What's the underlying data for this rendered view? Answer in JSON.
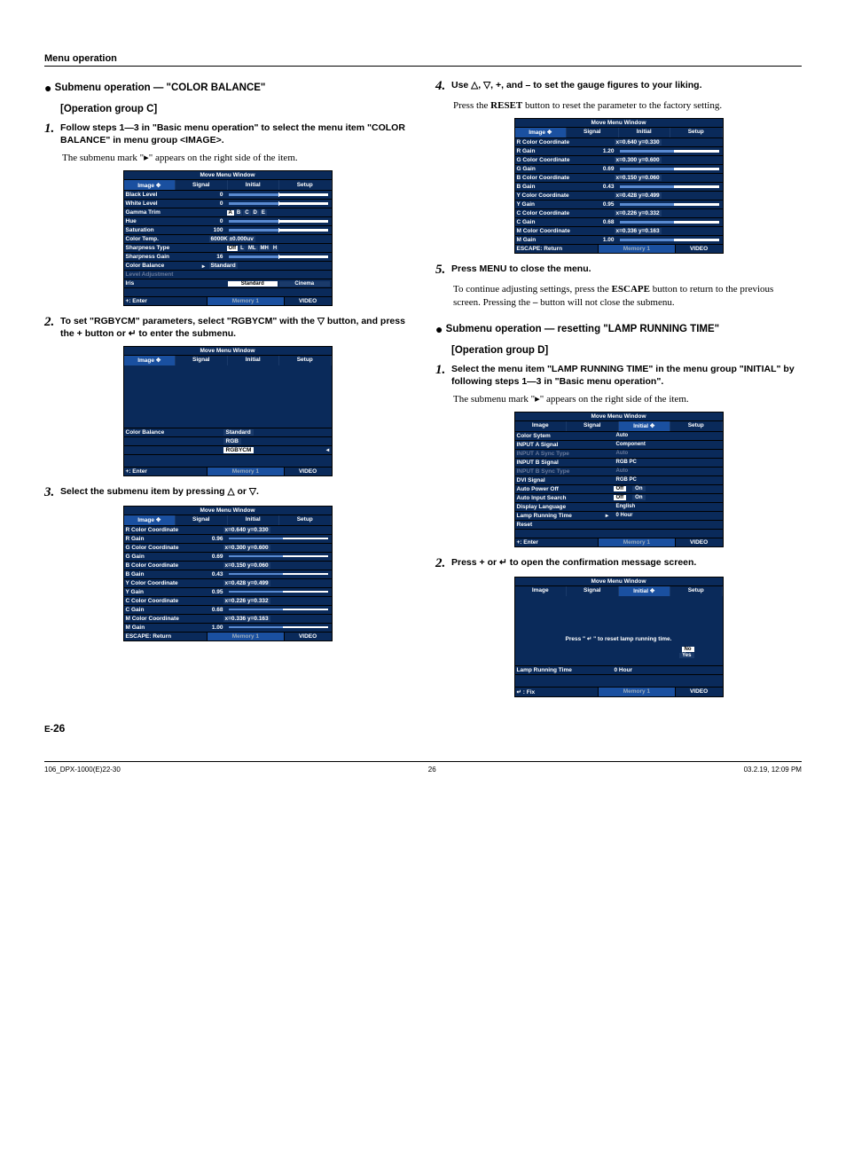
{
  "header": "Menu operation",
  "page_number_prefix": "E-",
  "page_number": "26",
  "footer": {
    "left": "106_DPX-1000(E)22-30",
    "center": "26",
    "right": "03.2.19, 12:09 PM"
  },
  "osd_common": {
    "title": "Move Menu Window",
    "tabs": [
      "Image",
      "Signal",
      "Initial",
      "Setup"
    ],
    "foot_enter": "+: Enter",
    "foot_escape": "ESCAPE: Return",
    "foot_fix": "↵ : Fix",
    "memory": "Memory 1",
    "video": "VIDEO"
  },
  "left": {
    "submenu_title": "Submenu operation — \"COLOR BALANCE\"",
    "opgroup": "[Operation group C]",
    "step1": "Follow steps 1—3 in \"Basic menu operation\" to select the menu item \"COLOR BALANCE\" in menu group <IMAGE>.",
    "step1_body_a": "The submenu mark \"",
    "step1_body_b": "\" appears on the right side of the item.",
    "osd1_rows": [
      {
        "label": "Black Level",
        "val": "0",
        "type": "gauge",
        "fill": 50
      },
      {
        "label": "White Level",
        "val": "0",
        "type": "gauge",
        "fill": 50
      },
      {
        "label": "Gamma Trim",
        "val": "",
        "type": "segs",
        "segs": [
          "A",
          "B",
          "C",
          "D",
          "E"
        ]
      },
      {
        "label": "Hue",
        "val": "0",
        "type": "gauge",
        "fill": 50
      },
      {
        "label": "Saturation",
        "val": "100",
        "type": "gauge",
        "fill": 50
      },
      {
        "label": "Color Temp.",
        "val": "",
        "type": "text",
        "text": "6000K  ±0.000uv"
      },
      {
        "label": "Sharpness Type",
        "val": "",
        "type": "segs",
        "segs": [
          "Off",
          "L",
          "ML",
          "MH",
          "H"
        ]
      },
      {
        "label": "Sharpness Gain",
        "val": "16",
        "type": "gauge",
        "fill": 50
      },
      {
        "label": "Color Balance",
        "val": "",
        "type": "text",
        "text": "Standard",
        "mark": "▸"
      },
      {
        "label": "Level Adjustment",
        "val": "",
        "type": "blank",
        "dim": true
      },
      {
        "label": "Iris",
        "val": "",
        "type": "opts",
        "opts": [
          "Standard",
          "Cinema"
        ]
      },
      {
        "label": "",
        "val": "",
        "type": "blank"
      }
    ],
    "step2": "To set \"RGBYCM\" parameters, select \"RGBYCM\" with the ▽ button, and press the + button or ↵ to enter the submenu.",
    "osd2_rows": [
      {
        "label": "Color Balance",
        "type": "text",
        "text": "Standard"
      },
      {
        "label": "",
        "type": "text",
        "text": "RGB"
      },
      {
        "label": "",
        "type": "text",
        "text": "RGBYCM",
        "mark": "◂"
      }
    ],
    "step3": "Select the submenu item by pressing △ or ▽.",
    "coord_rows": [
      {
        "label": "R Color Coordinate",
        "text": "x=0.640  y=0.330"
      },
      {
        "label": "R Gain",
        "val": "0.96"
      },
      {
        "label": "G Color Coordinate",
        "text": "x=0.300  y=0.600"
      },
      {
        "label": "G Gain",
        "val": "0.69"
      },
      {
        "label": "B Color Coordinate",
        "text": "x=0.150  y=0.060"
      },
      {
        "label": "B Gain",
        "val": "0.43"
      },
      {
        "label": "Y Color Coordinate",
        "text": "x=0.428  y=0.499"
      },
      {
        "label": "Y Gain",
        "val": "0.95"
      },
      {
        "label": "C Color Coordinate",
        "text": "x=0.226  y=0.332"
      },
      {
        "label": "C Gain",
        "val": "0.68"
      },
      {
        "label": "M Color Coordinate",
        "text": "x=0.336  y=0.163"
      },
      {
        "label": "M Gain",
        "val": "1.00"
      }
    ]
  },
  "right": {
    "step4": "Use △, ▽, +, and – to set the gauge figures to your liking.",
    "step4_body_a": "Press the ",
    "step4_body_reset": "RESET",
    "step4_body_b": " button to reset the parameter to the factory setting.",
    "osd4_gain_rows": [
      {
        "label": "R Color Coordinate",
        "text": "x=0.640  y=0.330"
      },
      {
        "label": "R Gain",
        "val": "1.20"
      },
      {
        "label": "G Color Coordinate",
        "text": "x=0.300  y=0.600"
      },
      {
        "label": "G Gain",
        "val": "0.69"
      },
      {
        "label": "B Color Coordinate",
        "text": "x=0.150  y=0.060"
      },
      {
        "label": "B Gain",
        "val": "0.43"
      },
      {
        "label": "Y Color Coordinate",
        "text": "x=0.428  y=0.499"
      },
      {
        "label": "Y Gain",
        "val": "0.95"
      },
      {
        "label": "C Color Coordinate",
        "text": "x=0.226  y=0.332"
      },
      {
        "label": "C Gain",
        "val": "0.68"
      },
      {
        "label": "M Color Coordinate",
        "text": "x=0.336  y=0.163"
      },
      {
        "label": "M Gain",
        "val": "1.00"
      }
    ],
    "step5": "Press MENU to close the menu.",
    "step5_body_a": "To continue adjusting settings, press the ",
    "step5_body_escape": "ESCAPE",
    "step5_body_b": " button to return to the previous screen. Pressing the ",
    "step5_body_minus": "–",
    "step5_body_c": " button will not close the submenu.",
    "submenu_title": "Submenu operation — resetting \"LAMP RUNNING TIME\"",
    "opgroup": "[Operation group D]",
    "stepD1": "Select the menu item \"LAMP RUNNING TIME\" in the menu group \"INITIAL\" by following steps 1—3 in \"Basic menu operation\".",
    "stepD1_body_a": "The submenu mark \"",
    "stepD1_body_b": "\" appears on the right side of the item.",
    "osdD1_rows": [
      {
        "label": "Color Sytem",
        "text": "Auto"
      },
      {
        "label": "INPUT A Signal",
        "text": "Component"
      },
      {
        "label": "INPUT A Sync Type",
        "text": "Auto",
        "dim": true
      },
      {
        "label": "INPUT B Signal",
        "text": "RGB PC"
      },
      {
        "label": "INPUT B Sync Type",
        "text": "Auto",
        "dim": true
      },
      {
        "label": "DVI Signal",
        "text": "RGB PC"
      },
      {
        "label": "Auto Power Off",
        "text": "Off",
        "opt2": "On"
      },
      {
        "label": "Auto Input Search",
        "text": "Off",
        "opt2": "On"
      },
      {
        "label": "Display Language",
        "text": "English"
      },
      {
        "label": "Lamp Running Time",
        "text": "0 Hour",
        "mark": "▸"
      },
      {
        "label": "Reset",
        "text": ""
      }
    ],
    "stepD2": "Press + or ↵ to open the confirmation message screen.",
    "confirm_msg": "Press  \" ↵ \"  to reset lamp running time.",
    "confirm_no": "No",
    "confirm_yes": "Yes",
    "confirm_lamp": "Lamp Running Time",
    "confirm_hour": "0 Hour"
  }
}
